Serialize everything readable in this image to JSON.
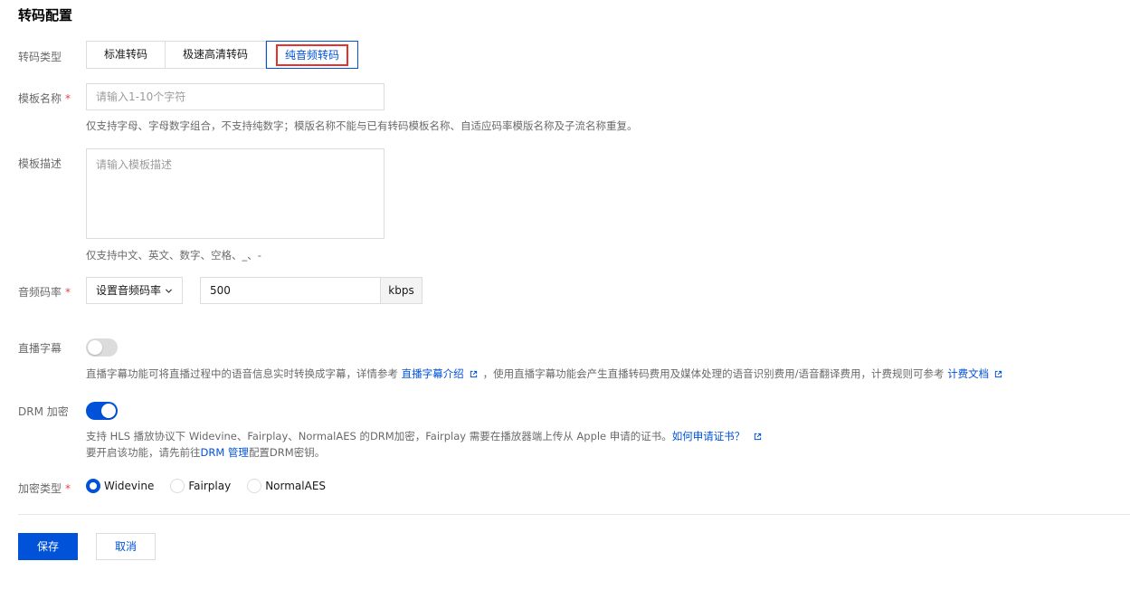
{
  "page": {
    "title": "转码配置"
  },
  "transcode_type": {
    "label": "转码类型",
    "options": [
      "标准转码",
      "极速高清转码",
      "纯音频转码"
    ],
    "selected": "纯音频转码"
  },
  "template_name": {
    "label": "模板名称",
    "required_mark": "*",
    "placeholder": "请输入1-10个字符",
    "value": "",
    "help": "仅支持字母、字母数字组合，不支持纯数字；模版名称不能与已有转码模板名称、自适应码率模版名称及子流名称重复。"
  },
  "template_desc": {
    "label": "模板描述",
    "placeholder": "请输入模板描述",
    "value": "",
    "help": "仅支持中文、英文、数字、空格、_、-"
  },
  "audio_bitrate": {
    "label": "音频码率",
    "required_mark": "*",
    "select_value": "设置音频码率",
    "value": "500",
    "unit": "kbps"
  },
  "live_subtitle": {
    "label": "直播字幕",
    "enabled": false,
    "help_prefix": "直播字幕功能可将直播过程中的语音信息实时转换成字幕，详情参考",
    "help_link": "直播字幕介绍",
    "help_mid": "，使用直播字幕功能会产生直播转码费用及媒体处理的语音识别费用/语音翻译费用，计费规则可参考",
    "help_link2": "计费文档"
  },
  "drm": {
    "label": "DRM 加密",
    "enabled": true,
    "help_line1_prefix": "支持 HLS 播放协议下 Widevine、Fairplay、NormalAES 的DRM加密，Fairplay 需要在播放器端上传从 Apple 申请的证书。",
    "help_line1_link": "如何申请证书？",
    "help_line2_prefix": "要开启该功能，请先前往",
    "help_line2_link": "DRM 管理",
    "help_line2_suffix": "配置DRM密钥。"
  },
  "encrypt_type": {
    "label": "加密类型",
    "required_mark": "*",
    "options": [
      "Widevine",
      "Fairplay",
      "NormalAES"
    ],
    "selected": "Widevine"
  },
  "actions": {
    "save": "保存",
    "cancel": "取消"
  },
  "colors": {
    "primary": "#0052d9",
    "highlight_border": "#e5322d",
    "required": "#e54545"
  },
  "icons": {
    "external_link": "external-link-icon",
    "select_arrow": "chevron-down-icon"
  }
}
